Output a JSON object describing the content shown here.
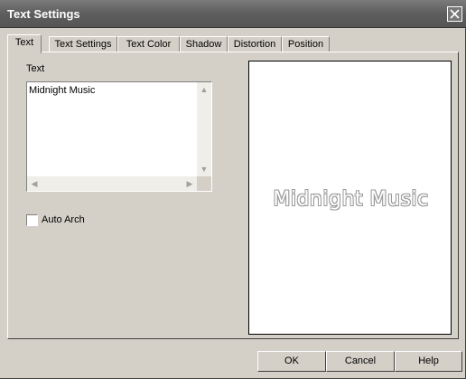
{
  "window": {
    "title": "Text Settings"
  },
  "tabs": [
    {
      "label": "Text",
      "active": true
    },
    {
      "label": "Text Settings",
      "active": false
    },
    {
      "label": "Text Color",
      "active": false
    },
    {
      "label": "Shadow",
      "active": false
    },
    {
      "label": "Distortion",
      "active": false
    },
    {
      "label": "Position",
      "active": false
    }
  ],
  "text_tab": {
    "text_label": "Text",
    "text_value": "Midnight Music",
    "auto_arch_label": "Auto Arch",
    "auto_arch_checked": false
  },
  "preview": {
    "text": "Midnight Music"
  },
  "buttons": {
    "ok": "OK",
    "cancel": "Cancel",
    "help": "Help"
  },
  "icons": {
    "close": "close-icon",
    "scroll_up": "scroll-up-arrow-icon",
    "scroll_down": "scroll-down-arrow-icon",
    "scroll_left": "scroll-left-arrow-icon",
    "scroll_right": "scroll-right-arrow-icon"
  }
}
